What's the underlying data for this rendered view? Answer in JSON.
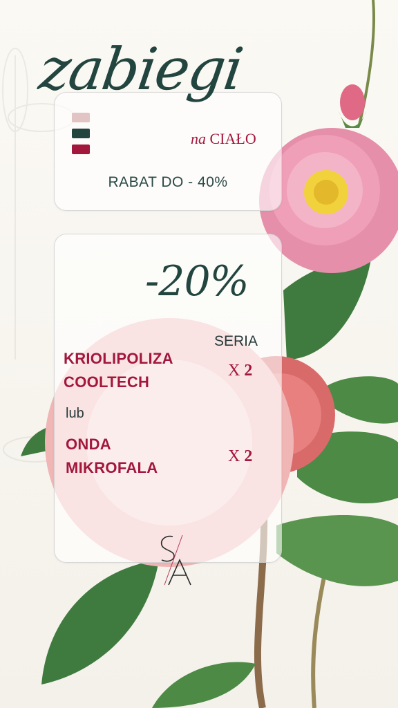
{
  "header": {
    "title": "zabiegi",
    "subtitle_a": "na",
    "subtitle_b": "CIAŁO"
  },
  "palette": {
    "swatches": [
      "#e2c4c4",
      "#23453f",
      "#a3173d"
    ]
  },
  "promo": {
    "rabat": "RABAT DO - 40%"
  },
  "offer": {
    "discount": "-20%",
    "seria_label": "SERIA",
    "items": [
      {
        "line1": "KRIOLIPOLIZA",
        "line2": "COOLTECH",
        "x": "X",
        "count": "2"
      },
      {
        "line1": "ONDA",
        "line2": "MIKROFALA",
        "x": "X",
        "count": "2"
      }
    ],
    "separator": "lub"
  },
  "logo": {
    "text": "SA"
  }
}
